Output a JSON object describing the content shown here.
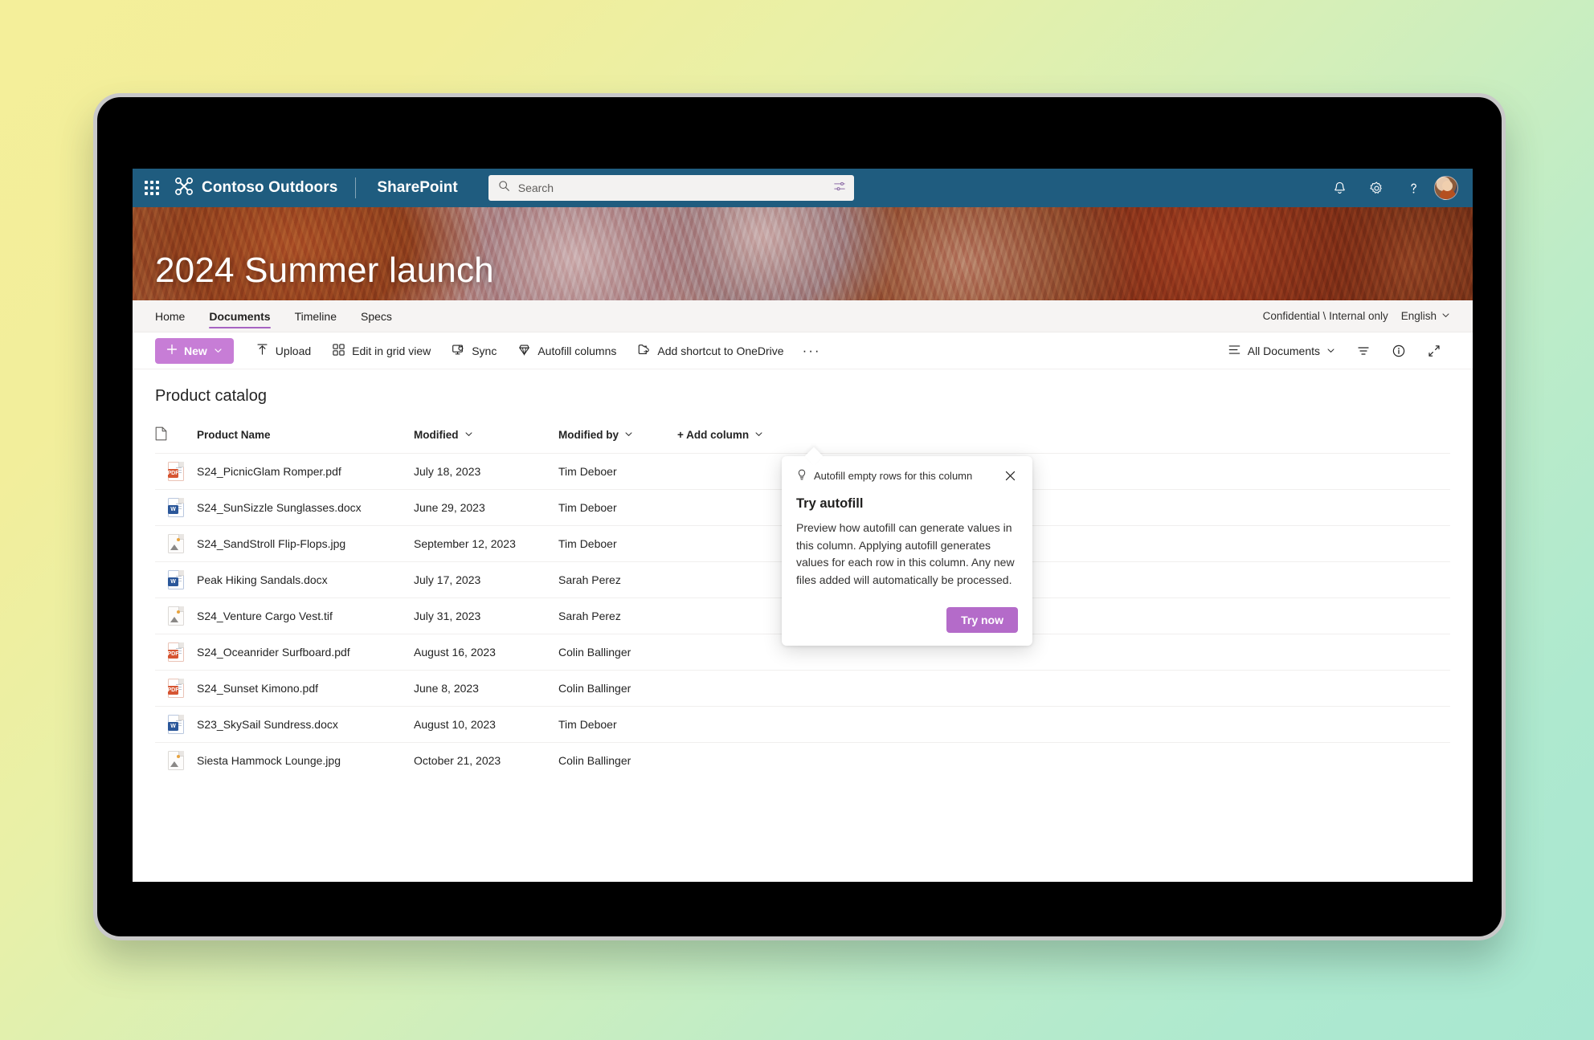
{
  "suitebar": {
    "waffle_label": "App launcher",
    "brand": "Contoso Outdoors",
    "app_name": "SharePoint",
    "search_placeholder": "Search",
    "search_value": "",
    "filter_icon": "search-filter-icon",
    "notifications_icon": "bell-icon",
    "settings_icon": "gear-icon",
    "help_icon": "help-icon",
    "avatar_label": "Account manager"
  },
  "hero": {
    "site_title": "2024 Summer launch"
  },
  "sitenav": {
    "links": [
      {
        "label": "Home",
        "active": false
      },
      {
        "label": "Documents",
        "active": true
      },
      {
        "label": "Timeline",
        "active": false
      },
      {
        "label": "Specs",
        "active": false
      }
    ],
    "sensitivity": "Confidential \\ Internal only",
    "language": "English"
  },
  "commandbar": {
    "new_label": "New",
    "items": [
      {
        "label": "Upload",
        "icon": "upload-icon"
      },
      {
        "label": "Edit in grid view",
        "icon": "grid-view-icon"
      },
      {
        "label": "Sync",
        "icon": "sync-icon"
      },
      {
        "label": "Autofill columns",
        "icon": "autofill-diamond-icon"
      },
      {
        "label": "Add shortcut to OneDrive",
        "icon": "onedrive-shortcut-icon"
      }
    ],
    "overflow_label": "···",
    "view_label": "All Documents",
    "filter_icon": "filter-icon",
    "info_icon": "info-icon",
    "expand_icon": "expand-icon"
  },
  "list": {
    "title": "Product catalog",
    "columns": {
      "icon": "",
      "name": "Product Name",
      "modified": "Modified",
      "modified_by": "Modified by",
      "add_column": "+ Add column"
    },
    "rows": [
      {
        "icon": "pdf",
        "name": "S24_PicnicGlam Romper.pdf",
        "modified": "July 18, 2023",
        "modified_by": "Tim Deboer"
      },
      {
        "icon": "docx",
        "name": "S24_SunSizzle Sunglasses.docx",
        "modified": "June 29, 2023",
        "modified_by": "Tim Deboer"
      },
      {
        "icon": "img",
        "name": "S24_SandStroll Flip-Flops.jpg",
        "modified": "September 12, 2023",
        "modified_by": "Tim Deboer"
      },
      {
        "icon": "docx",
        "name": "Peak Hiking Sandals.docx",
        "modified": "July 17, 2023",
        "modified_by": "Sarah Perez"
      },
      {
        "icon": "img",
        "name": "S24_Venture Cargo Vest.tif",
        "modified": "July 31, 2023",
        "modified_by": "Sarah Perez"
      },
      {
        "icon": "pdf",
        "name": "S24_Oceanrider Surfboard.pdf",
        "modified": "August 16, 2023",
        "modified_by": "Colin Ballinger"
      },
      {
        "icon": "pdf",
        "name": "S24_Sunset Kimono.pdf",
        "modified": "June 8, 2023",
        "modified_by": "Colin Ballinger"
      },
      {
        "icon": "docx",
        "name": "S23_SkySail Sundress.docx",
        "modified": "August 10, 2023",
        "modified_by": "Tim Deboer"
      },
      {
        "icon": "img",
        "name": "Siesta Hammock Lounge.jpg",
        "modified": "October 21, 2023",
        "modified_by": "Colin Ballinger"
      }
    ]
  },
  "callout": {
    "hint": "Autofill empty rows for this column",
    "hint_icon": "lightbulb-icon",
    "close_icon": "close-icon",
    "title": "Try autofill",
    "body": "Preview how autofill can generate values in this column. Applying autofill generates values for each row in this column. Any new files added will automatically be processed.",
    "action_label": "Try now"
  },
  "colors": {
    "suitebar_blue": "#1f5c7f",
    "accent_purple": "#c77dd6",
    "button_purple": "#b46bc9",
    "tab_underline": "#a764c2",
    "pdf_red": "#d65532",
    "word_blue": "#2b579a"
  }
}
